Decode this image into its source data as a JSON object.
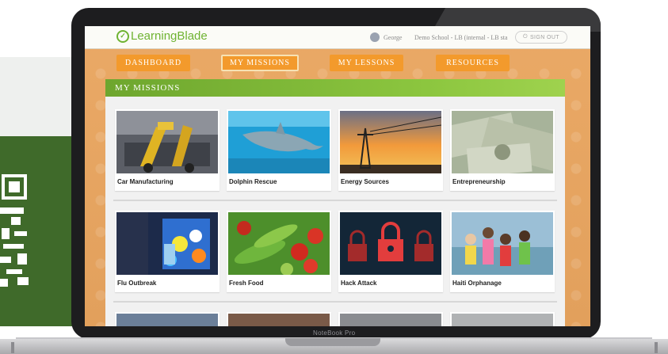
{
  "app": {
    "logo_text": "LearningBlade",
    "user_name": "George",
    "school": "Demo School - LB (internal - LB sta",
    "signout_label": "SIGN OUT"
  },
  "nav": {
    "items": [
      {
        "label": "DASHBOARD"
      },
      {
        "label": "MY MISSIONS"
      },
      {
        "label": "MY LESSONS"
      },
      {
        "label": "RESOURCES"
      }
    ],
    "active": "MY MISSIONS"
  },
  "missions": {
    "title": "MY MISSIONS",
    "cards": [
      {
        "label": "Car Manufacturing"
      },
      {
        "label": "Dolphin Rescue"
      },
      {
        "label": "Energy Sources"
      },
      {
        "label": "Entrepreneurship"
      },
      {
        "label": "Flu Outbreak"
      },
      {
        "label": "Fresh Food"
      },
      {
        "label": "Hack Attack"
      },
      {
        "label": "Haiti Orphanage"
      }
    ]
  },
  "device": {
    "label": "NoteBook Pro"
  },
  "colors": {
    "nav_orange": "#f39a2c",
    "brand_green": "#6fb332",
    "header_green": "#8cc63f",
    "background_orange": "#e7a664"
  }
}
